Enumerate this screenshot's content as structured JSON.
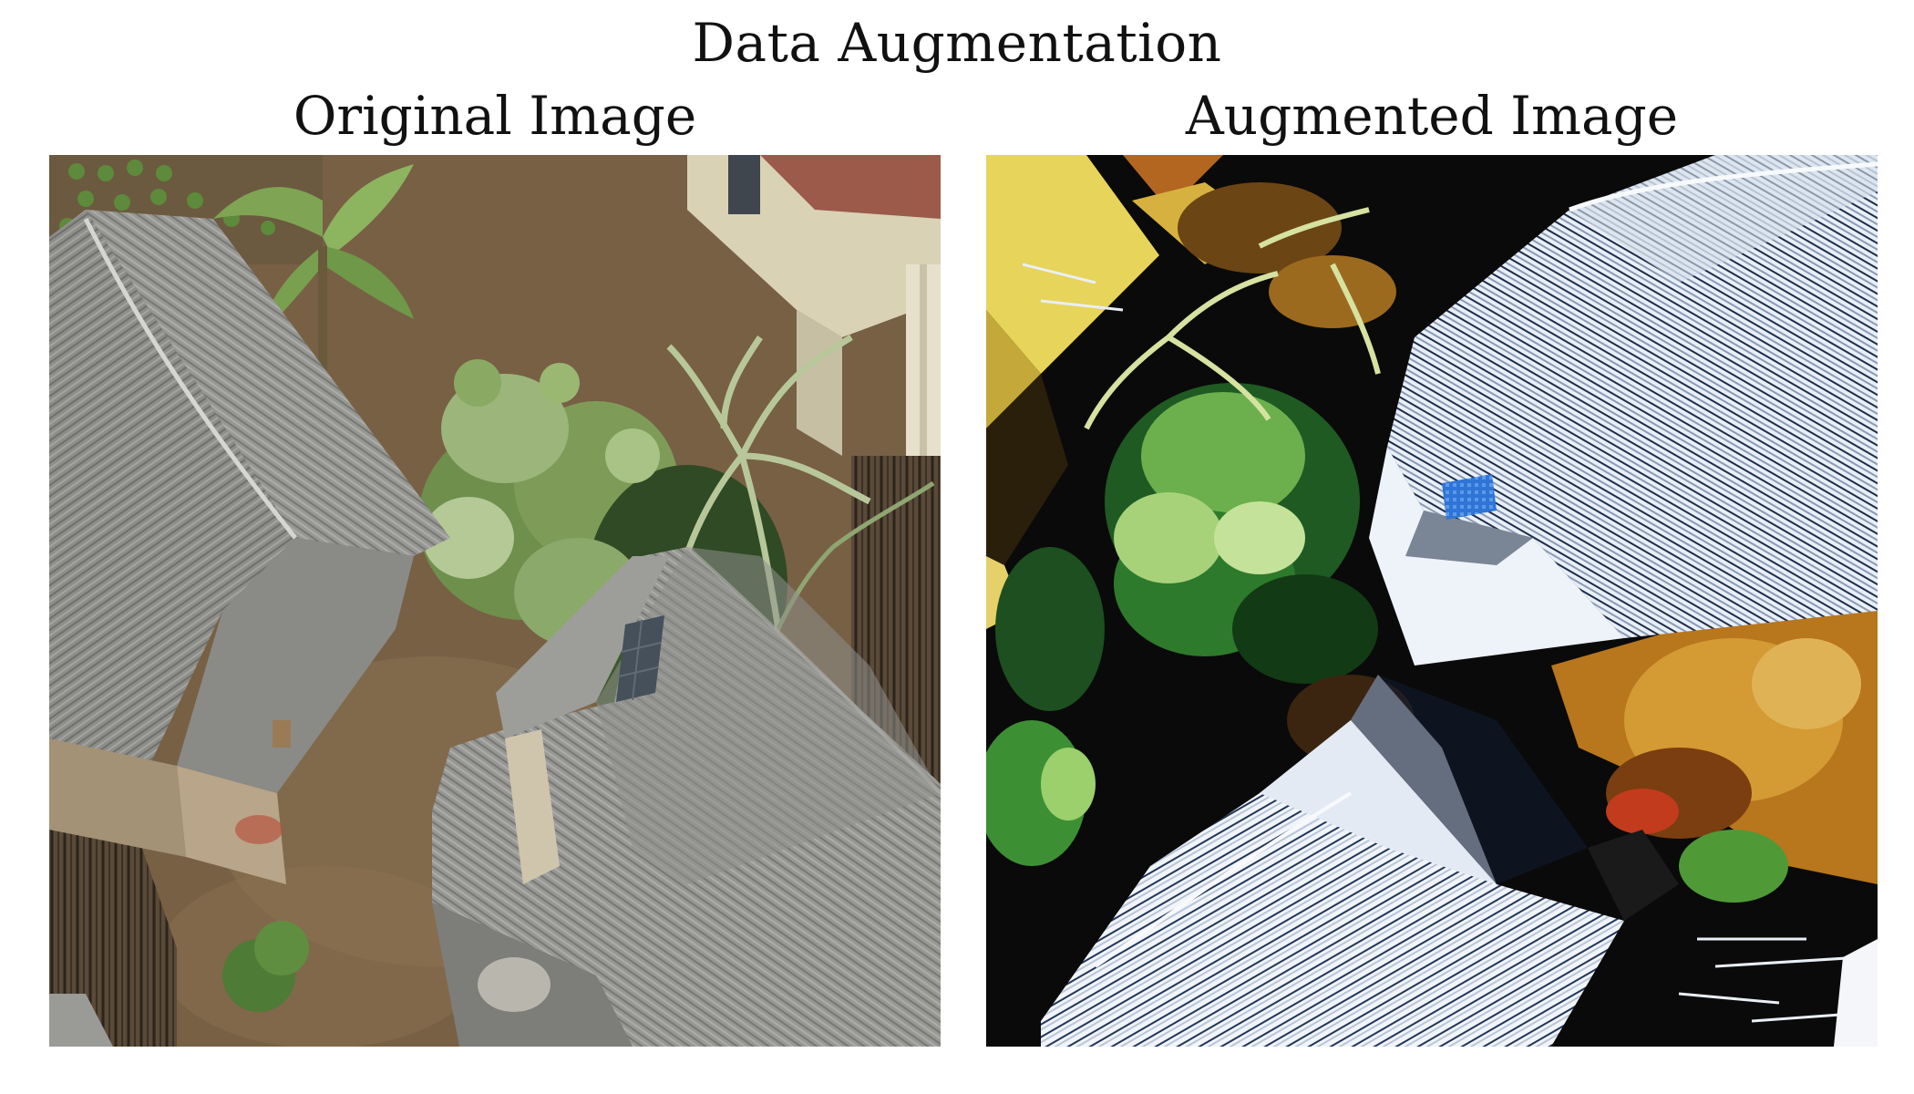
{
  "figure": {
    "suptitle": "Data Augmentation"
  },
  "panels": [
    {
      "title": "Original Image",
      "content": "aerial photo of thatched-roof huts with vegetation and dirt ground"
    },
    {
      "title": "Augmented Image",
      "content": "rotated, high-contrast, color-shifted version of the aerial photo"
    }
  ],
  "colors": {
    "original_roof": "#8f8f8c",
    "original_ground": "#7a6447",
    "original_foliage": "#5f7d3c",
    "augmented_roof": "#e9eff7",
    "augmented_shadow": "#0a0a0a",
    "augmented_ground": "#c98a2a",
    "augmented_foliage": "#2f8a2e",
    "solar_panel_original": "#45505a",
    "solar_panel_augmented": "#2f74d6"
  }
}
